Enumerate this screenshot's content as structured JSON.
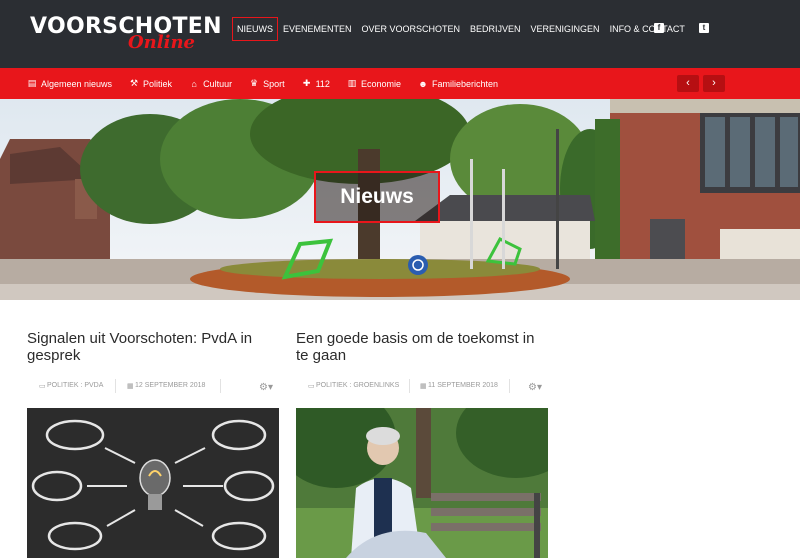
{
  "logo": {
    "main": "VOORSCHOTEN",
    "sub": "Online"
  },
  "mainnav": [
    {
      "label": "NIEUWS",
      "active": true
    },
    {
      "label": "EVENEMENTEN"
    },
    {
      "label": "OVER VOORSCHOTEN"
    },
    {
      "label": "BEDRIJVEN"
    },
    {
      "label": "VERENIGINGEN"
    },
    {
      "label": "INFO & CONTACT"
    }
  ],
  "social": {
    "facebook": "f",
    "twitter": "t"
  },
  "categories": [
    {
      "label": "Algemeen nieuws",
      "icon": "newspaper-icon",
      "glyph": "▤"
    },
    {
      "label": "Politiek",
      "icon": "gavel-icon",
      "glyph": "⚒"
    },
    {
      "label": "Cultuur",
      "icon": "bank-icon",
      "glyph": "⌂"
    },
    {
      "label": "Sport",
      "icon": "trophy-icon",
      "glyph": "♛"
    },
    {
      "label": "112",
      "icon": "ambulance-icon",
      "glyph": "✚"
    },
    {
      "label": "Economie",
      "icon": "bar-chart-icon",
      "glyph": "▥"
    },
    {
      "label": "Familieberichten",
      "icon": "users-icon",
      "glyph": "☻"
    }
  ],
  "arrows": {
    "prev": "‹",
    "next": "›"
  },
  "hero": {
    "title": "Nieuws"
  },
  "articles": [
    {
      "title": "Signalen uit Voorschoten: PvdA in gesprek",
      "category": "POLITIEK : PVDA",
      "date": "12 SEPTEMBER 2018"
    },
    {
      "title": "Een goede basis om de toekomst in te gaan",
      "category": "POLITIEK : GROENLINKS",
      "date": "11 SEPTEMBER 2018"
    }
  ],
  "colors": {
    "brand_red": "#e8161b",
    "header_dark": "#2b2e33"
  }
}
